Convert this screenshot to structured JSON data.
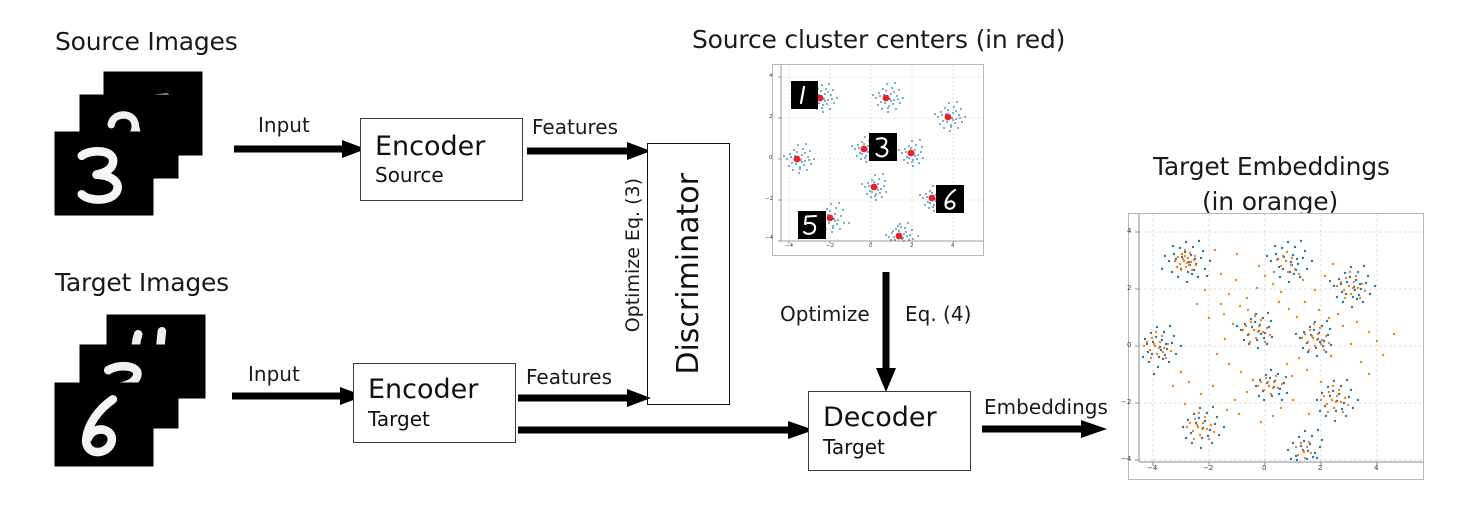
{
  "titles": {
    "source_images": "Source Images",
    "target_images": "Target Images",
    "source_clusters": "Source cluster centers (in red)",
    "target_embeddings_line1": "Target Embeddings",
    "target_embeddings_line2": "(in orange)"
  },
  "boxes": {
    "encoder_source": {
      "main": "Encoder",
      "sub": "Source"
    },
    "encoder_target": {
      "main": "Encoder",
      "sub": "Target"
    },
    "decoder_target": {
      "main": "Decoder",
      "sub": "Target"
    },
    "discriminator": {
      "label": "Discriminator"
    }
  },
  "edges": {
    "input_source": "Input",
    "input_target": "Input",
    "features_source": "Features",
    "features_target": "Features",
    "optimize_eq3": "Optimize Eq. (3)",
    "optimize_eq4_left": "Optimize",
    "optimize_eq4_right": "Eq. (4)",
    "embeddings": "Embeddings"
  },
  "colors": {
    "source_points": "#1f77b4",
    "target_points": "#ff7f0e",
    "cluster_center": "#f02020",
    "box_border": "#3c3c3c",
    "arrow": "#000000",
    "grid": "#cccccc"
  },
  "chart_data": [
    {
      "id": "source_clusters",
      "type": "scatter",
      "title": "Source cluster centers (in red)",
      "xlabel": "",
      "ylabel": "",
      "xlim": [
        -5.2,
        5.2
      ],
      "ylim": [
        -5.2,
        5.2
      ],
      "xticks": [
        -4,
        -2,
        0,
        2,
        4
      ],
      "yticks": [
        -4,
        -2,
        0,
        2,
        4
      ],
      "grid": true,
      "legend": "none",
      "series": [
        {
          "name": "source samples",
          "color": "#1f77b4",
          "marker": "point",
          "points_per_cluster": 160
        },
        {
          "name": "cluster centers",
          "color": "#f02020",
          "marker": "o"
        }
      ],
      "clusters": [
        {
          "label": "1",
          "center": [
            -2.45,
            3.0
          ],
          "spread": 0.55,
          "digit": "1",
          "digit_pos": "left"
        },
        {
          "center": [
            0.75,
            3.0
          ],
          "spread": 0.55
        },
        {
          "center": [
            3.8,
            2.1
          ],
          "spread": 0.55
        },
        {
          "center": [
            -3.6,
            0.0
          ],
          "spread": 0.55
        },
        {
          "label": "3",
          "center": [
            -0.35,
            0.5
          ],
          "spread": 0.45,
          "digit": "3",
          "digit_pos": "right"
        },
        {
          "center": [
            1.95,
            0.3
          ],
          "spread": 0.45
        },
        {
          "center": [
            0.15,
            -1.35
          ],
          "spread": 0.45
        },
        {
          "label": "6",
          "center": [
            3.0,
            -1.9
          ],
          "spread": 0.45,
          "digit": "6",
          "digit_pos": "right"
        },
        {
          "label": "5",
          "center": [
            -2.0,
            -2.85
          ],
          "spread": 0.5,
          "digit": "5",
          "digit_pos": "left"
        },
        {
          "center": [
            1.35,
            -3.85
          ],
          "spread": 0.5
        }
      ]
    },
    {
      "id": "target_embeddings",
      "type": "scatter",
      "title": "Target Embeddings (in orange)",
      "xlabel": "",
      "ylabel": "",
      "xlim": [
        -5.2,
        5.2
      ],
      "ylim": [
        -5.2,
        5.2
      ],
      "xticks": [
        -4,
        -2,
        0,
        2,
        4
      ],
      "yticks": [
        -4,
        -2,
        0,
        2,
        4
      ],
      "grid": true,
      "legend": "none",
      "series": [
        {
          "name": "source embeddings",
          "color": "#1f77b4",
          "marker": "point"
        },
        {
          "name": "target embeddings",
          "color": "#ff7f0e",
          "marker": "point"
        }
      ],
      "clusters": [
        {
          "center": [
            -2.45,
            3.0
          ],
          "spread": 0.62
        },
        {
          "center": [
            0.75,
            3.0
          ],
          "spread": 0.62
        },
        {
          "center": [
            3.0,
            2.1
          ],
          "spread": 0.6
        },
        {
          "center": [
            -3.5,
            0.0
          ],
          "spread": 0.62
        },
        {
          "center": [
            -0.4,
            0.55
          ],
          "spread": 0.5
        },
        {
          "center": [
            1.7,
            0.3
          ],
          "spread": 0.5
        },
        {
          "center": [
            0.15,
            -1.4
          ],
          "spread": 0.45
        },
        {
          "center": [
            2.4,
            -1.9
          ],
          "spread": 0.55
        },
        {
          "center": [
            -2.0,
            -2.85
          ],
          "spread": 0.6
        },
        {
          "center": [
            1.35,
            -3.85
          ],
          "spread": 0.6
        }
      ],
      "scatter_noise": "orange diffuse points bridging clusters"
    }
  ],
  "digit_thumbnails": {
    "source_stack": [
      "7",
      "2",
      "3"
    ],
    "target_stack": [
      "4",
      "3",
      "6"
    ],
    "cluster_labels": [
      "1",
      "3",
      "6",
      "5"
    ]
  }
}
